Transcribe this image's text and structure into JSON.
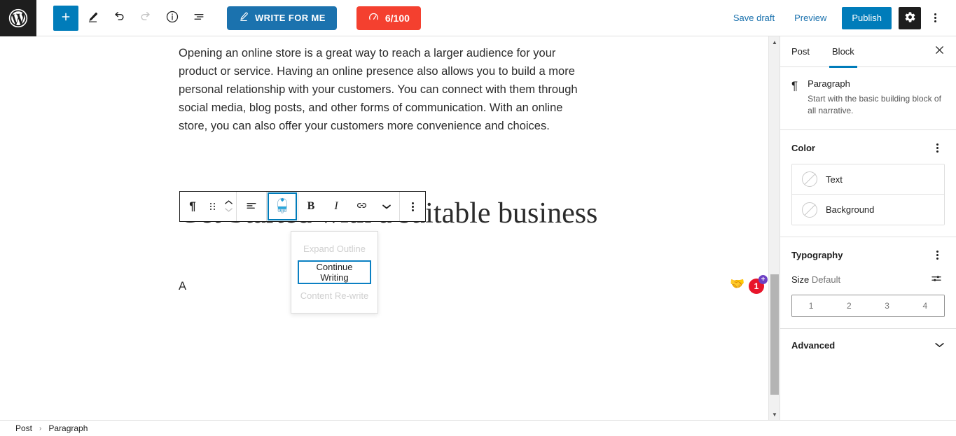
{
  "topbar": {
    "logo_icon": "wordpress-logo-icon",
    "add_block_label": "+",
    "tools": [
      {
        "name": "add-block-button",
        "icon": "plus-icon"
      },
      {
        "name": "edit-tool-button",
        "icon": "pencil-icon"
      },
      {
        "name": "undo-button",
        "icon": "undo-arrow-icon"
      },
      {
        "name": "redo-button",
        "icon": "redo-arrow-icon"
      },
      {
        "name": "details-button",
        "icon": "info-circle-icon"
      },
      {
        "name": "list-view-button",
        "icon": "list-view-icon"
      }
    ],
    "write_for_me_label": "WRITE FOR ME",
    "write_for_me_icon": "pen-underline-icon",
    "score_label": "6/100",
    "score_icon": "gauge-icon",
    "save_draft_label": "Save draft",
    "preview_label": "Preview",
    "publish_label": "Publish",
    "settings_icon": "gear-icon",
    "options_icon": "kebab-menu-icon",
    "accent_blue": "#007cba",
    "write_blue": "#1b72ae",
    "score_red": "#f4402f"
  },
  "editor": {
    "paragraph_text": "Opening an online store is a great way to reach a larger audience for your product or service. Having an online presence also allows you to build a more personal relationship with your customers. You can connect with them through social media, blog posts, and other forms of communication. With an online store, you can also offer your customers more convenience and choices.",
    "heading_text": "Get Started with a suitable business",
    "empty_paragraph_text": "A",
    "handshake_emoji": "🤝",
    "badge_count": "1",
    "badge_plus": "+"
  },
  "block_toolbar": {
    "items": [
      {
        "name": "block-type-paragraph-button",
        "icon": "pilcrow-icon",
        "label": "¶"
      },
      {
        "name": "drag-handle-button",
        "icon": "drag-dots-icon",
        "label": ""
      },
      {
        "name": "move-block-button",
        "icon": "chevron-up-down-icon",
        "label": ""
      },
      {
        "name": "align-text-button",
        "icon": "align-left-icon",
        "label": ""
      },
      {
        "name": "ai-assistant-button",
        "icon": "ai-robot-icon",
        "label": ""
      },
      {
        "name": "bold-button",
        "icon": "bold-icon",
        "label": "B"
      },
      {
        "name": "italic-button",
        "icon": "italic-icon",
        "label": "I"
      },
      {
        "name": "link-button",
        "icon": "link-icon",
        "label": ""
      },
      {
        "name": "more-formatting-button",
        "icon": "chevron-down-icon",
        "label": ""
      },
      {
        "name": "block-options-button",
        "icon": "kebab-menu-icon",
        "label": ""
      }
    ]
  },
  "ai_menu": {
    "items": [
      {
        "label": "Expand Outline",
        "enabled": false
      },
      {
        "label": "Continue Writing",
        "enabled": true
      },
      {
        "label": "Content Re-write",
        "enabled": false
      }
    ],
    "focus_color": "#0b80c3"
  },
  "sidebar": {
    "tab_post_label": "Post",
    "tab_block_label": "Block",
    "active_tab": "Block",
    "close_icon": "close-x-icon",
    "block_card": {
      "icon": "paragraph-pilcrow-icon",
      "title": "Paragraph",
      "description": "Start with the basic building block of all narrative."
    },
    "color": {
      "section_title": "Color",
      "options_icon": "kebab-menu-icon",
      "rows": [
        {
          "label": "Text",
          "swatch": "empty-swatch-icon"
        },
        {
          "label": "Background",
          "swatch": "empty-swatch-icon"
        }
      ]
    },
    "typography": {
      "section_title": "Typography",
      "options_icon": "kebab-menu-icon",
      "size_label": "Size",
      "size_value": "Default",
      "size_toggle_icon": "sliders-icon",
      "size_buttons": [
        "1",
        "2",
        "3",
        "4"
      ]
    },
    "advanced": {
      "label": "Advanced",
      "chevron_icon": "chevron-down-icon"
    }
  },
  "bottombar": {
    "crumbs": [
      "Post",
      "Paragraph"
    ],
    "separator": "›"
  },
  "scrollbar": {
    "up_icon": "triangle-up-icon",
    "down_icon": "triangle-down-icon",
    "thumb": "scrollbar-thumb"
  }
}
